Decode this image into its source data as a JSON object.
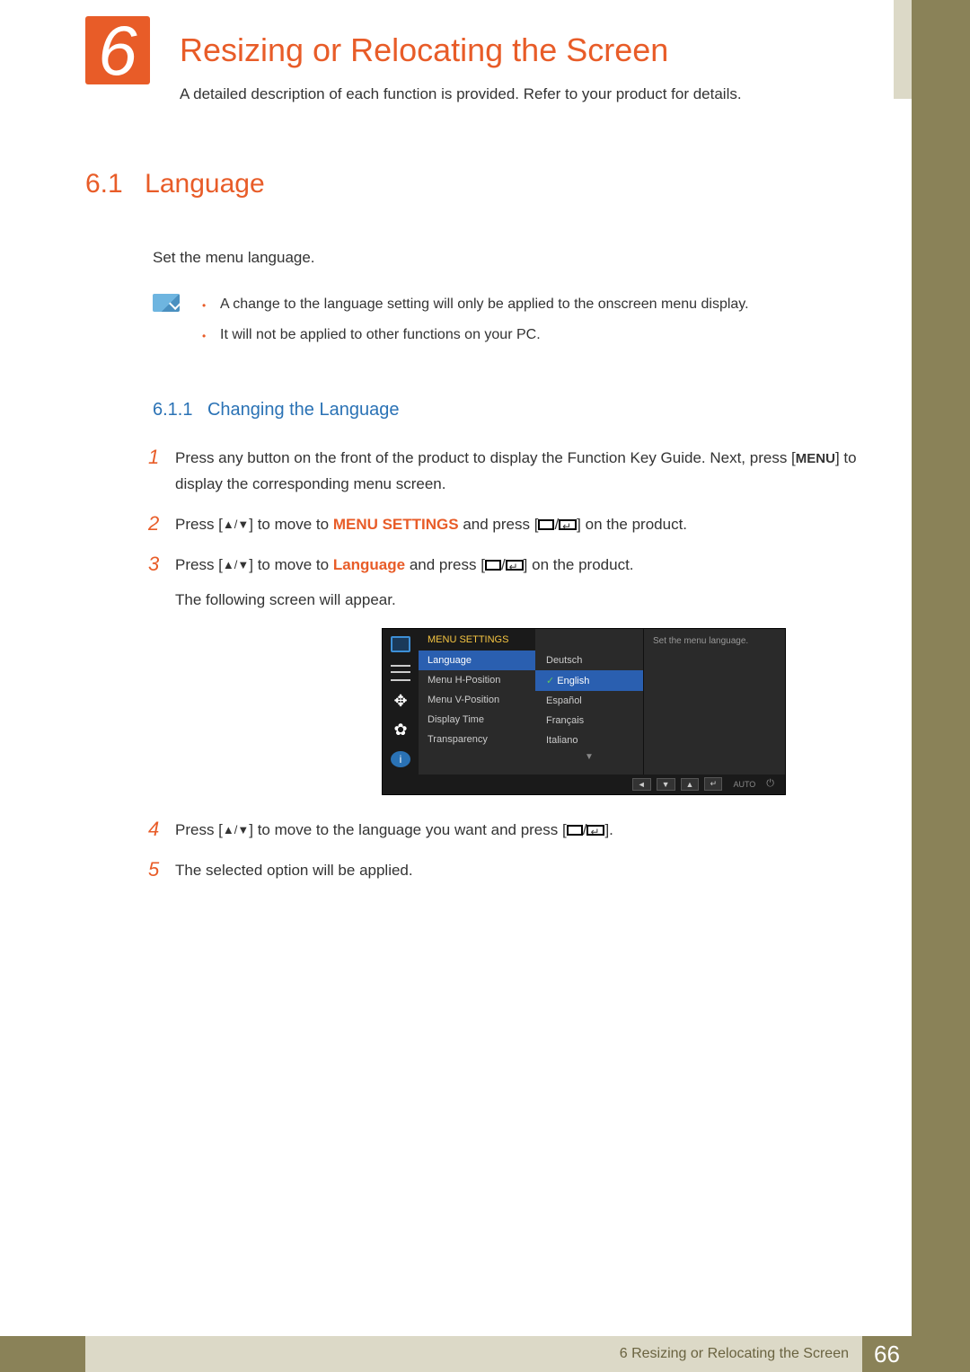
{
  "chapter": {
    "number": "6",
    "title": "Resizing or Relocating the Screen"
  },
  "intro": "A detailed description of each function is provided. Refer to your product for details.",
  "section": {
    "number": "6.1",
    "title": "Language",
    "body": "Set the menu language."
  },
  "notes": [
    "A change to the language setting will only be applied to the onscreen menu display.",
    "It will not be applied to other functions on your PC."
  ],
  "subsection": {
    "number": "6.1.1",
    "title": "Changing the Language"
  },
  "steps": {
    "s1a": "Press any button on the front of the product to display the Function Key Guide. Next, press [",
    "s1menu": "MENU",
    "s1b": "] to display the corresponding menu screen.",
    "s2a": "Press [",
    "s2arrows": "▲/▼",
    "s2b": "] to move to ",
    "s2target": "MENU SETTINGS",
    "s2c": " and press [",
    "s2d": "] on the product.",
    "s3a": "Press [",
    "s3arrows": "▲/▼",
    "s3b": "] to move to ",
    "s3target": "Language",
    "s3c": " and press [",
    "s3d": "] on the product.",
    "s3e": "The following screen will appear.",
    "s4a": "Press [",
    "s4arrows": "▲/▼",
    "s4b": "] to move to the language you want and press [",
    "s4c": "].",
    "s5": "The selected option will be applied."
  },
  "osd": {
    "header": "MENU SETTINGS",
    "items": [
      "Language",
      "Menu H-Position",
      "Menu V-Position",
      "Display Time",
      "Transparency"
    ],
    "options": [
      "Deutsch",
      "English",
      "Español",
      "Français",
      "Italiano"
    ],
    "selected_option_index": 1,
    "selected_item_index": 0,
    "help": "Set the menu language.",
    "footer_auto": "AUTO",
    "footer_buttons": [
      "◄",
      "▼",
      "▲",
      "↵"
    ]
  },
  "footer": {
    "chapter_ref": "6 Resizing or Relocating the Screen",
    "page": "66"
  }
}
